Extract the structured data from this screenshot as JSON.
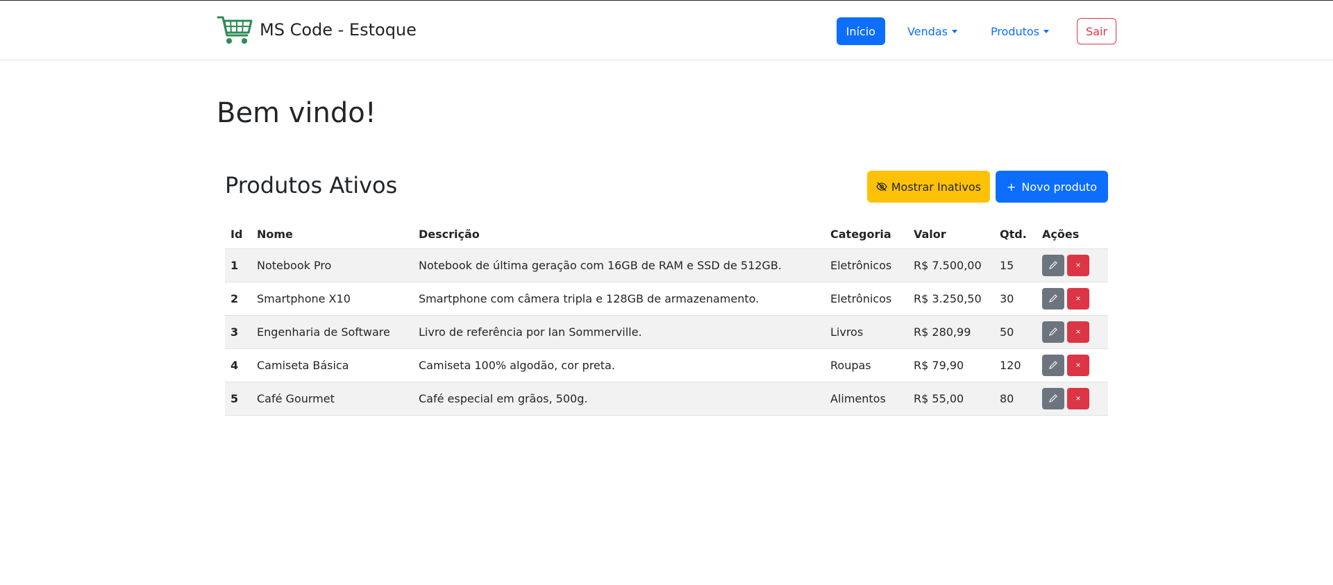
{
  "brand": {
    "title": "MS Code - Estoque",
    "logo_icon": "shopping-cart-icon",
    "logo_color": "#2e8b57"
  },
  "nav": {
    "home": "Início",
    "sales": "Vendas",
    "products": "Produtos",
    "logout": "Sair"
  },
  "page": {
    "welcome": "Bem vindo!",
    "section_title": "Produtos Ativos",
    "show_inactive": "Mostrar Inativos",
    "new_product": "Novo produto"
  },
  "table": {
    "headers": [
      "Id",
      "Nome",
      "Descrição",
      "Categoria",
      "Valor",
      "Qtd.",
      "Ações"
    ],
    "rows": [
      {
        "id": "1",
        "name": "Notebook Pro",
        "description": "Notebook de última geração com 16GB de RAM e SSD de 512GB.",
        "category": "Eletrônicos",
        "price": "R$ 7.500,00",
        "qty": "15"
      },
      {
        "id": "2",
        "name": "Smartphone X10",
        "description": "Smartphone com câmera tripla e 128GB de armazenamento.",
        "category": "Eletrônicos",
        "price": "R$ 3.250,50",
        "qty": "30"
      },
      {
        "id": "3",
        "name": "Engenharia de Software",
        "description": "Livro de referência por Ian Sommerville.",
        "category": "Livros",
        "price": "R$ 280,99",
        "qty": "50"
      },
      {
        "id": "4",
        "name": "Camiseta Básica",
        "description": "Camiseta 100% algodão, cor preta.",
        "category": "Roupas",
        "price": "R$ 79,90",
        "qty": "120"
      },
      {
        "id": "5",
        "name": "Café Gourmet",
        "description": "Café especial em grãos, 500g.",
        "category": "Alimentos",
        "price": "R$ 55,00",
        "qty": "80"
      }
    ]
  },
  "colors": {
    "primary": "#0d6efd",
    "warning": "#ffc107",
    "danger": "#dc3545",
    "secondary": "#6c757d"
  }
}
